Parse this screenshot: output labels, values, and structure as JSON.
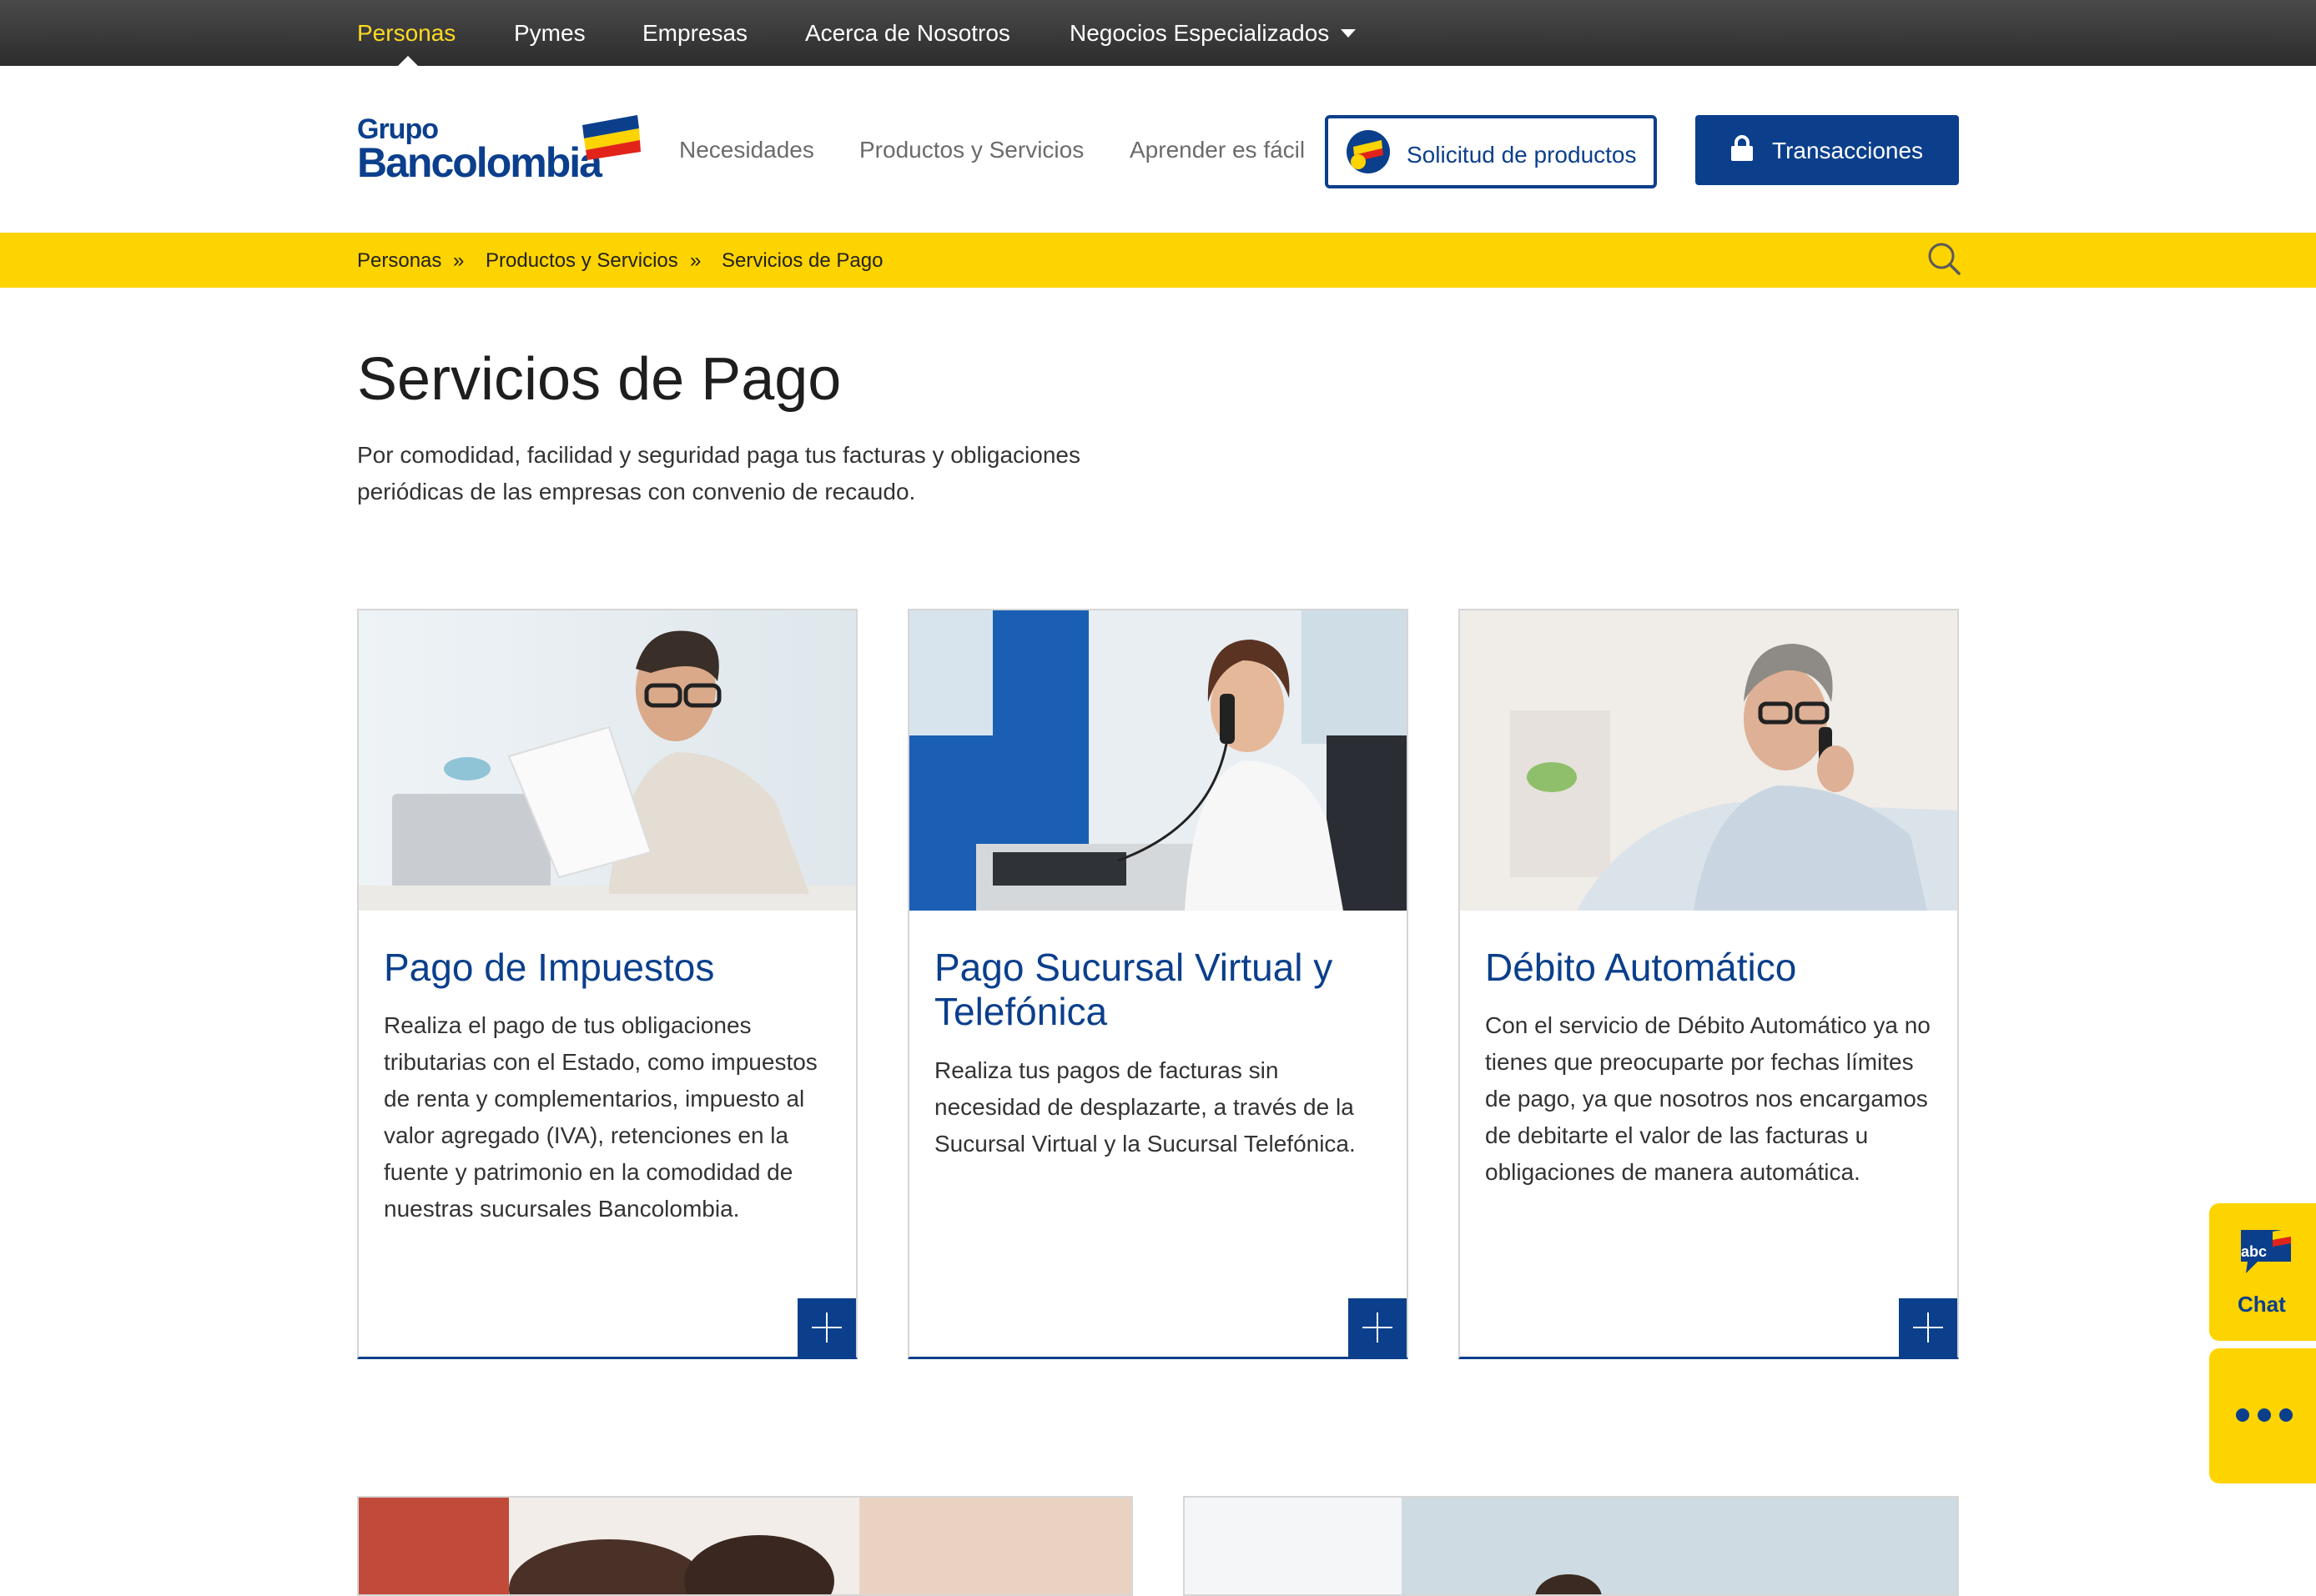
{
  "topnav": {
    "items": [
      {
        "label": "Personas"
      },
      {
        "label": "Pymes"
      },
      {
        "label": "Empresas"
      },
      {
        "label": "Acerca de Nosotros"
      },
      {
        "label": "Negocios Especializados"
      }
    ]
  },
  "header": {
    "logo_line1": "Grupo",
    "logo_line2": "Bancolombia",
    "nav": [
      "Necesidades",
      "Productos y Servicios",
      "Aprender es fácil"
    ],
    "solicitud_label": "Solicitud de productos",
    "transacciones_label": "Transacciones"
  },
  "breadcrumb": {
    "items": [
      "Personas",
      "Productos y Servicios",
      "Servicios de Pago"
    ],
    "separator": "»"
  },
  "page": {
    "title": "Servicios de Pago",
    "description": "Por comodidad, facilidad y seguridad paga tus facturas y obligaciones periódicas de las empresas con convenio de recaudo."
  },
  "cards": [
    {
      "title": "Pago de Impuestos",
      "text": "Realiza el pago de tus obligaciones tributarias con el Estado, como impuestos de renta y complementarios, impuesto al valor agregado (IVA), retenciones en la fuente y patrimonio en la comodidad de nuestras sucursales Bancolombia."
    },
    {
      "title": "Pago Sucursal Virtual y Telefónica",
      "text": "Realiza tus pagos de facturas sin necesidad de desplazarte, a través de la Sucursal Virtual y la Sucursal Telefónica."
    },
    {
      "title": "Débito Automático",
      "text": "Con el servicio de Débito Automático ya no tienes que preocuparte por fechas límites de pago, ya que nosotros nos encargamos de debitarte el valor de las facturas u obligaciones de manera automática."
    }
  ],
  "side": {
    "chat_badge": "abc",
    "chat_label": "Chat"
  },
  "colors": {
    "brand_blue": "#0b3f8c",
    "brand_yellow": "#fdd300",
    "topbar": "#3a3a3a",
    "active_nav": "#fdda24"
  }
}
